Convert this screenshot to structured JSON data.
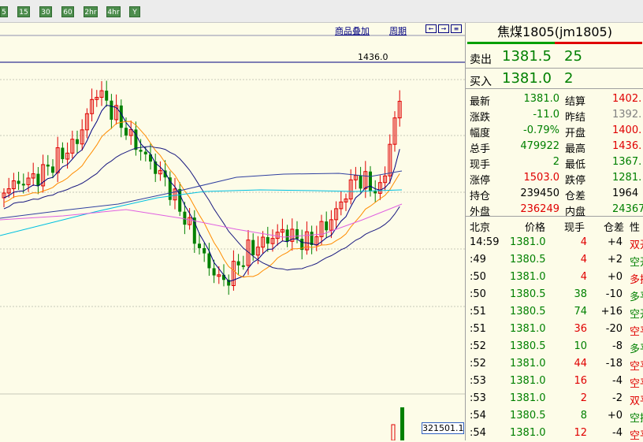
{
  "toolbar": {
    "buttons": [
      "5",
      "15",
      "30",
      "60",
      "2hr",
      "4hr",
      "Y"
    ]
  },
  "chart": {
    "links": [
      "商品叠加",
      "周期"
    ],
    "price_tag": "1436.0",
    "volume_value": "321501.1"
  },
  "quote": {
    "title": "焦煤1805(jm1805)",
    "sell_label": "卖出",
    "sell_price": "1381.5",
    "sell_vol": "25",
    "buy_label": "买入",
    "buy_price": "1381.0",
    "buy_vol": "2",
    "stats": [
      {
        "l1": "最新",
        "v1": "1381.0",
        "c1": "green",
        "l2": "结算",
        "v2": "1402.",
        "c2": "red"
      },
      {
        "l1": "涨跌",
        "v1": "-11.0",
        "c1": "green",
        "l2": "昨结",
        "v2": "1392.",
        "c2": "gray"
      },
      {
        "l1": "幅度",
        "v1": "-0.79%",
        "c1": "green",
        "l2": "开盘",
        "v2": "1400.",
        "c2": "red"
      },
      {
        "l1": "总手",
        "v1": "479922",
        "c1": "green",
        "l2": "最高",
        "v2": "1436.",
        "c2": "red"
      },
      {
        "l1": "现手",
        "v1": "2",
        "c1": "green",
        "l2": "最低",
        "v2": "1367.",
        "c2": "green"
      },
      {
        "l1": "涨停",
        "v1": "1503.0",
        "c1": "red",
        "l2": "跌停",
        "v2": "1281.",
        "c2": "green"
      },
      {
        "l1": "持仓",
        "v1": "239450",
        "c1": "black",
        "l2": "仓差",
        "v2": "1964",
        "c2": "black"
      },
      {
        "l1": "外盘",
        "v1": "236249",
        "c1": "red",
        "l2": "内盘",
        "v2": "24367",
        "c2": "green"
      }
    ],
    "ticks_header": {
      "time": "北京",
      "price": "价格",
      "vol": "现手",
      "chg": "仓差",
      "type": "性"
    },
    "ticks": [
      {
        "time": "14:59",
        "price": "1381.0",
        "pc": "green",
        "vol": "4",
        "vc": "red",
        "chg": "+4",
        "type": "双开",
        "tc": "red"
      },
      {
        "time": ":49",
        "price": "1380.5",
        "pc": "green",
        "vol": "4",
        "vc": "red",
        "chg": "+2",
        "type": "空开",
        "tc": "green"
      },
      {
        "time": ":50",
        "price": "1381.0",
        "pc": "green",
        "vol": "4",
        "vc": "red",
        "chg": "+0",
        "type": "多换",
        "tc": "red"
      },
      {
        "time": ":50",
        "price": "1380.5",
        "pc": "green",
        "vol": "38",
        "vc": "green",
        "chg": "-10",
        "type": "多平",
        "tc": "green"
      },
      {
        "time": ":51",
        "price": "1380.5",
        "pc": "green",
        "vol": "74",
        "vc": "green",
        "chg": "+16",
        "type": "空开",
        "tc": "green"
      },
      {
        "time": ":51",
        "price": "1381.0",
        "pc": "green",
        "vol": "36",
        "vc": "red",
        "chg": "-20",
        "type": "空平",
        "tc": "red"
      },
      {
        "time": ":52",
        "price": "1380.5",
        "pc": "green",
        "vol": "10",
        "vc": "green",
        "chg": "-8",
        "type": "多平",
        "tc": "green"
      },
      {
        "time": ":52",
        "price": "1381.0",
        "pc": "green",
        "vol": "44",
        "vc": "red",
        "chg": "-18",
        "type": "空平",
        "tc": "red"
      },
      {
        "time": ":53",
        "price": "1381.0",
        "pc": "green",
        "vol": "16",
        "vc": "red",
        "chg": "-4",
        "type": "空平",
        "tc": "red"
      },
      {
        "time": ":53",
        "price": "1381.0",
        "pc": "green",
        "vol": "2",
        "vc": "red",
        "chg": "-2",
        "type": "双平",
        "tc": "red"
      },
      {
        "time": ":54",
        "price": "1380.5",
        "pc": "green",
        "vol": "8",
        "vc": "green",
        "chg": "+0",
        "type": "空换",
        "tc": "green"
      },
      {
        "time": ":54",
        "price": "1381.0",
        "pc": "green",
        "vol": "12",
        "vc": "red",
        "chg": "-4",
        "type": "空平",
        "tc": "red"
      }
    ]
  },
  "colors": {
    "up": "#e00000",
    "down": "#008000",
    "background": "#fdfce8",
    "ma5": "#000080",
    "ma10": "#ff8c00",
    "ma20": "#1a1a80",
    "ma60": "#00c0e0",
    "ma120": "#e060e0"
  }
}
